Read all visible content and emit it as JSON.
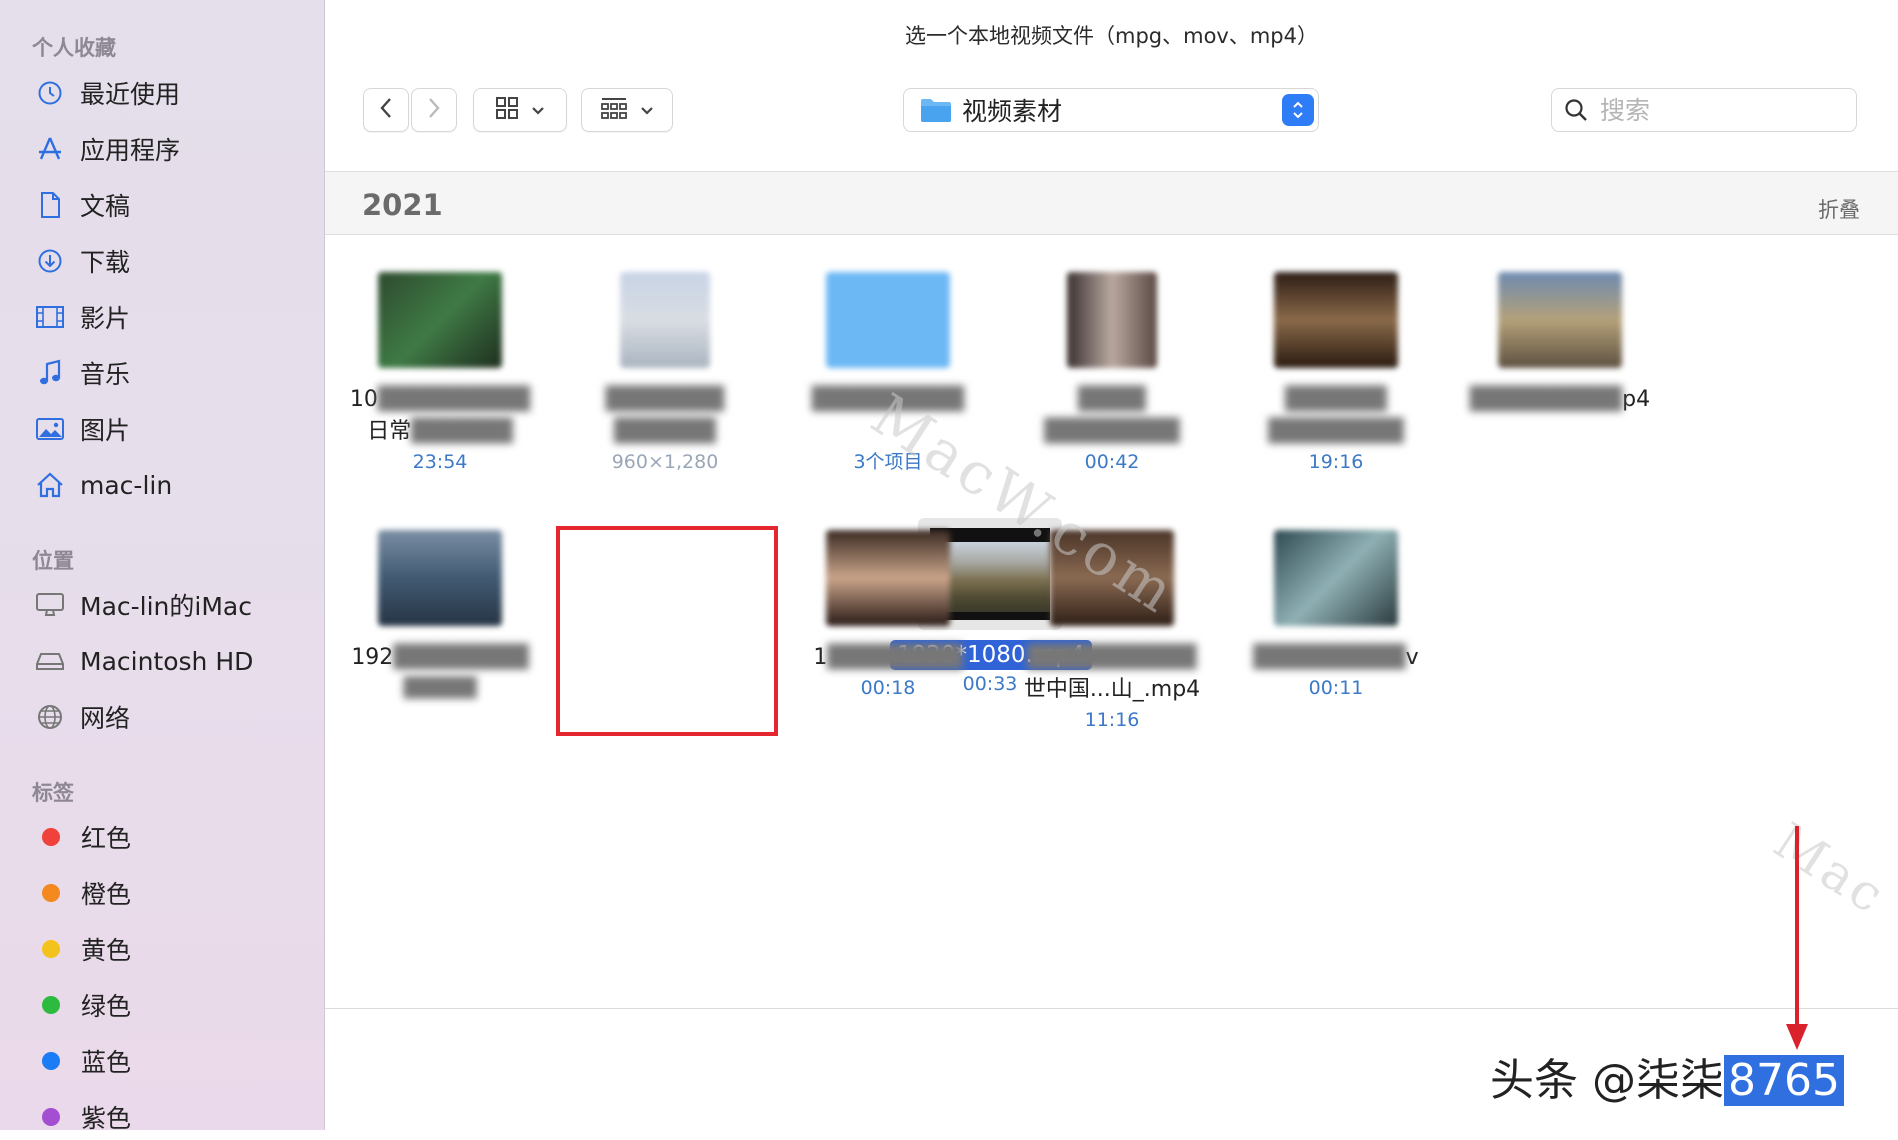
{
  "window": {
    "title": "选一个本地视频文件（mpg、mov、mp4）"
  },
  "sidebar": {
    "favorites_header": "个人收藏",
    "favorites": [
      {
        "label": "最近使用",
        "icon": "clock-icon"
      },
      {
        "label": "应用程序",
        "icon": "apps-icon"
      },
      {
        "label": "文稿",
        "icon": "document-icon"
      },
      {
        "label": "下载",
        "icon": "download-icon"
      },
      {
        "label": "影片",
        "icon": "film-icon"
      },
      {
        "label": "音乐",
        "icon": "music-icon"
      },
      {
        "label": "图片",
        "icon": "photo-icon"
      },
      {
        "label": "mac-lin",
        "icon": "home-icon"
      }
    ],
    "locations_header": "位置",
    "locations": [
      {
        "label": "Mac-lin的iMac",
        "icon": "computer-icon"
      },
      {
        "label": "Macintosh HD",
        "icon": "disk-icon"
      },
      {
        "label": "网络",
        "icon": "globe-icon"
      }
    ],
    "tags_header": "标签",
    "tags": [
      {
        "label": "红色",
        "color": "#f0413b"
      },
      {
        "label": "橙色",
        "color": "#f3891f"
      },
      {
        "label": "黄色",
        "color": "#f4c21c"
      },
      {
        "label": "绿色",
        "color": "#2dbb3f"
      },
      {
        "label": "蓝色",
        "color": "#1b7cf5"
      },
      {
        "label": "紫色",
        "color": "#a44fd2"
      }
    ]
  },
  "toolbar": {
    "location_label": "视频素材",
    "search_placeholder": "搜索"
  },
  "group": {
    "title": "2021",
    "collapse_label": "折叠"
  },
  "files": {
    "r1c1": {
      "name": "10",
      "name2": "日常",
      "sub": "23:54"
    },
    "r1c2": {
      "sub": "960×1,280"
    },
    "r1c3": {
      "sub": "3个项目"
    },
    "r1c4": {
      "sub": "00:42"
    },
    "r1c5": {
      "sub": "19:16"
    },
    "r1c6": {
      "name": "p4"
    },
    "r2c1": {
      "name": "192"
    },
    "r2c2": {
      "name": "1920*1080.mp4",
      "sub": "00:33"
    },
    "r2c3": {
      "name": "1",
      "sub": "00:18"
    },
    "r2c4": {
      "name": "世中国...山_.mp4",
      "sub": "11:16"
    },
    "r2c5": {
      "name": "v",
      "sub": "00:11"
    }
  },
  "watermarks": {
    "center": "MacW.com",
    "bottom_right": "Mac"
  },
  "credit": {
    "prefix": "头条 @",
    "highlight": "8765",
    "middle": "柒柒"
  }
}
